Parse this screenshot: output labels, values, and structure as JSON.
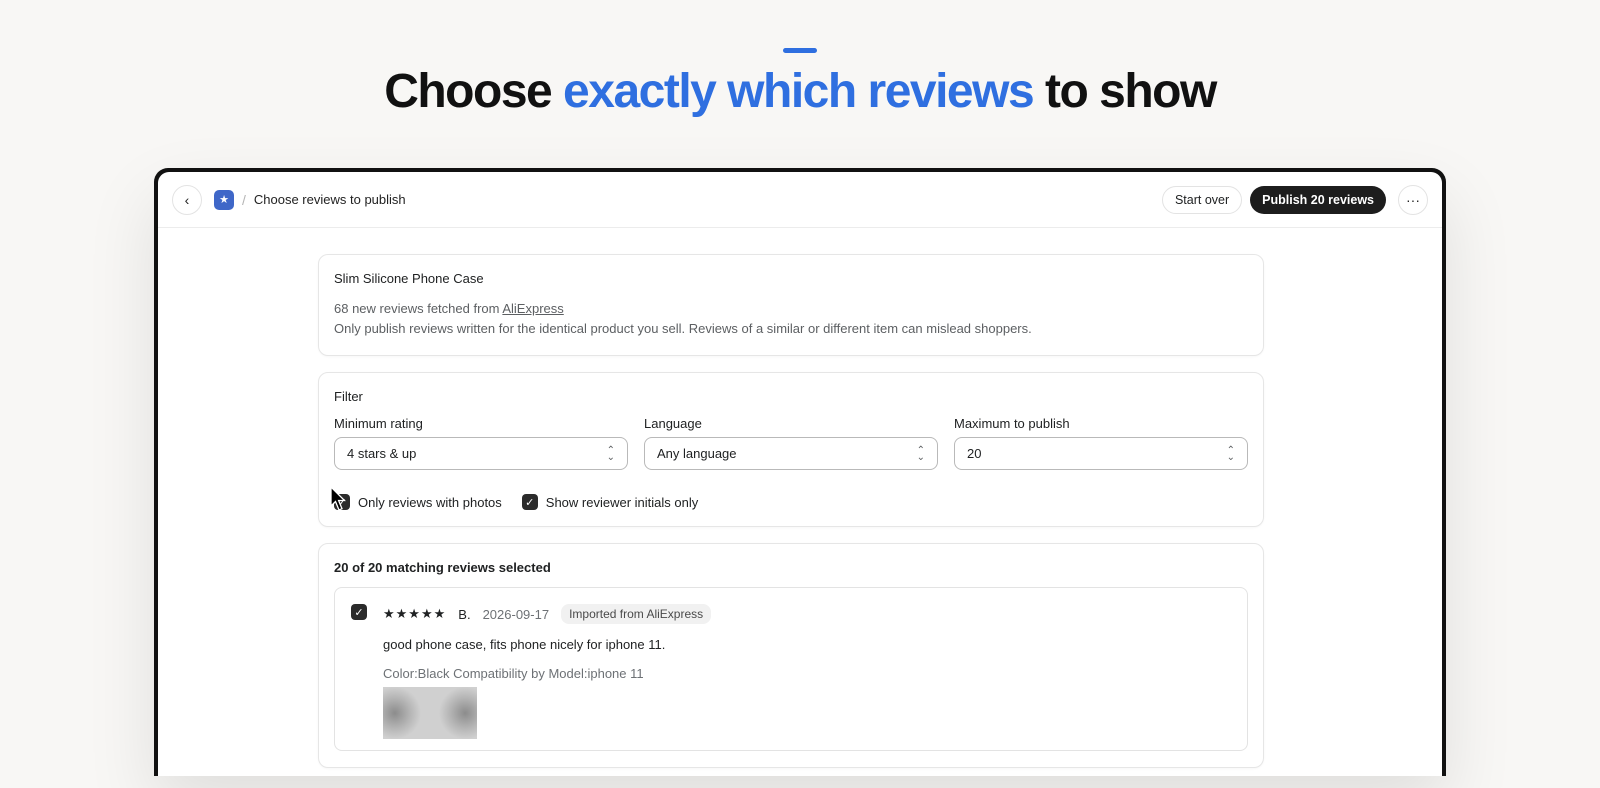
{
  "hero": {
    "title_before": "Choose ",
    "title_highlight": "exactly which reviews",
    "title_after": " to show"
  },
  "colors": {
    "accent": "#2f6fe0",
    "primary_button": "#1d1d1d",
    "checkbox": "#2b2b2b"
  },
  "topbar": {
    "back_icon": "chevron-left-icon",
    "app_icon": "star-badge-icon",
    "separator": "/",
    "page_title": "Choose reviews to publish",
    "start_over_label": "Start over",
    "publish_label": "Publish 20 reviews",
    "more_icon": "more-horizontal-icon"
  },
  "product": {
    "name": "Slim Silicone Phone Case",
    "fetched_prefix": "68 new reviews fetched from ",
    "source_link": "AliExpress",
    "note": "Only publish reviews written for the identical product you sell. Reviews of a similar or different item can mislead shoppers."
  },
  "filter": {
    "title": "Filter",
    "min_rating": {
      "label": "Minimum rating",
      "value": "4 stars & up"
    },
    "language": {
      "label": "Language",
      "value": "Any language"
    },
    "max_publish": {
      "label": "Maximum to publish",
      "value": "20"
    },
    "photos_only": {
      "label": "Only reviews with photos",
      "checked": true
    },
    "initials_only": {
      "label": "Show reviewer initials only",
      "checked": true
    }
  },
  "reviews": {
    "summary": "20 of 20 matching reviews selected",
    "items": [
      {
        "checked": true,
        "stars": "★★★★★",
        "rating": 5,
        "author": "B.",
        "date": "2026-09-17",
        "badge": "Imported from AliExpress",
        "text": "good phone case, fits phone nicely for iphone 11.",
        "variant": "Color:Black Compatibility by Model:iphone 11"
      }
    ]
  }
}
